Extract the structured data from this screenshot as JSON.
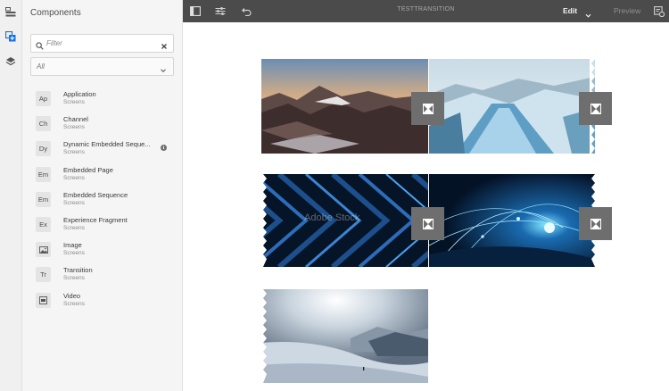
{
  "rail": {
    "icons": [
      "page-structure-icon",
      "components-icon",
      "layers-icon"
    ]
  },
  "panel": {
    "title": "Components",
    "filter_placeholder": "Filter",
    "group_select_value": "All",
    "items": [
      {
        "abbr": "Ap",
        "name": "Application",
        "group": "Screens"
      },
      {
        "abbr": "Ch",
        "name": "Channel",
        "group": "Screens"
      },
      {
        "abbr": "Dy",
        "name": "Dynamic Embedded Seque...",
        "group": "Screens"
      },
      {
        "abbr": "Em",
        "name": "Embedded Page",
        "group": "Screens"
      },
      {
        "abbr": "Em",
        "name": "Embedded Sequence",
        "group": "Screens"
      },
      {
        "abbr": "Ex",
        "name": "Experience Fragment",
        "group": "Screens"
      },
      {
        "abbr": "",
        "name": "Image",
        "group": "Screens",
        "icon": "image-icon"
      },
      {
        "abbr": "Tr",
        "name": "Transition",
        "group": "Screens"
      },
      {
        "abbr": "",
        "name": "Video",
        "group": "Screens",
        "icon": "video-icon"
      }
    ]
  },
  "toolbar": {
    "title": "TESTTRANSITION",
    "mode": "Edit",
    "preview": "Preview"
  },
  "canvas": {
    "watermark": "Adobe Stock",
    "placeholder_icon": "transition-placeholder-icon"
  },
  "colors": {
    "toolbar_bg": "#4b4b4b",
    "panel_bg": "#f5f5f5",
    "rail_bg": "#f0f0f0",
    "placeholder_bg": "#6e6e6e"
  }
}
